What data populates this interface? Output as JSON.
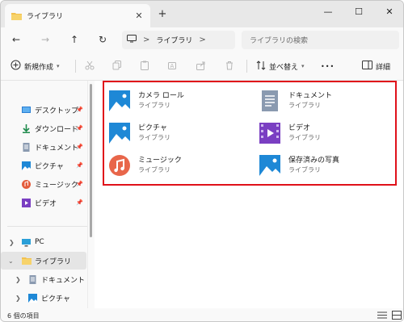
{
  "window": {
    "tab_title": "ライブラリ",
    "tab_close": "✕",
    "new_tab": "+",
    "controls": {
      "minimize": "—",
      "maximize": "☐",
      "close": "✕"
    }
  },
  "nav": {
    "back": "←",
    "forward": "→",
    "up": "↑",
    "refresh": "↻",
    "address_crumb": "ライブラリ",
    "address_sep": ">",
    "search_placeholder": "ライブラリの検索"
  },
  "toolbar": {
    "new_label": "新規作成",
    "sort_label": "並べ替え",
    "more_label": "•••",
    "details_label": "詳細"
  },
  "sidebar": {
    "quick_access": [
      {
        "label": "デスクトップ",
        "icon": "desktop-icon",
        "color": "#2a7fd4"
      },
      {
        "label": "ダウンロード",
        "icon": "download-icon",
        "color": "#1e8a4c"
      },
      {
        "label": "ドキュメント",
        "icon": "document-icon",
        "color": "#6a7b91"
      },
      {
        "label": "ピクチャ",
        "icon": "picture-icon",
        "color": "#1e88d6"
      },
      {
        "label": "ミュージック",
        "icon": "music-icon",
        "color": "#e45c3c"
      },
      {
        "label": "ビデオ",
        "icon": "video-icon",
        "color": "#7a3fc2"
      }
    ],
    "tree": [
      {
        "label": "PC",
        "icon": "pc-icon"
      },
      {
        "label": "ライブラリ",
        "icon": "library-folder-icon"
      },
      {
        "label": "ドキュメント",
        "icon": "document-icon"
      },
      {
        "label": "ピクチャ",
        "icon": "picture-icon"
      }
    ]
  },
  "libraries": [
    {
      "name": "カメラ ロール",
      "sub": "ライブラリ",
      "icon": "camera-roll-icon"
    },
    {
      "name": "ドキュメント",
      "sub": "ライブラリ",
      "icon": "documents-library-icon"
    },
    {
      "name": "ピクチャ",
      "sub": "ライブラリ",
      "icon": "pictures-library-icon"
    },
    {
      "name": "ビデオ",
      "sub": "ライブラリ",
      "icon": "videos-library-icon"
    },
    {
      "name": "ミュージック",
      "sub": "ライブラリ",
      "icon": "music-library-icon"
    },
    {
      "name": "保存済みの写真",
      "sub": "ライブラリ",
      "icon": "saved-pictures-icon"
    }
  ],
  "status": {
    "item_count": "6 個の項目"
  },
  "colors": {
    "accent": "#1e88d6",
    "highlight_border": "#e0101a",
    "folder": "#f2c14e"
  }
}
